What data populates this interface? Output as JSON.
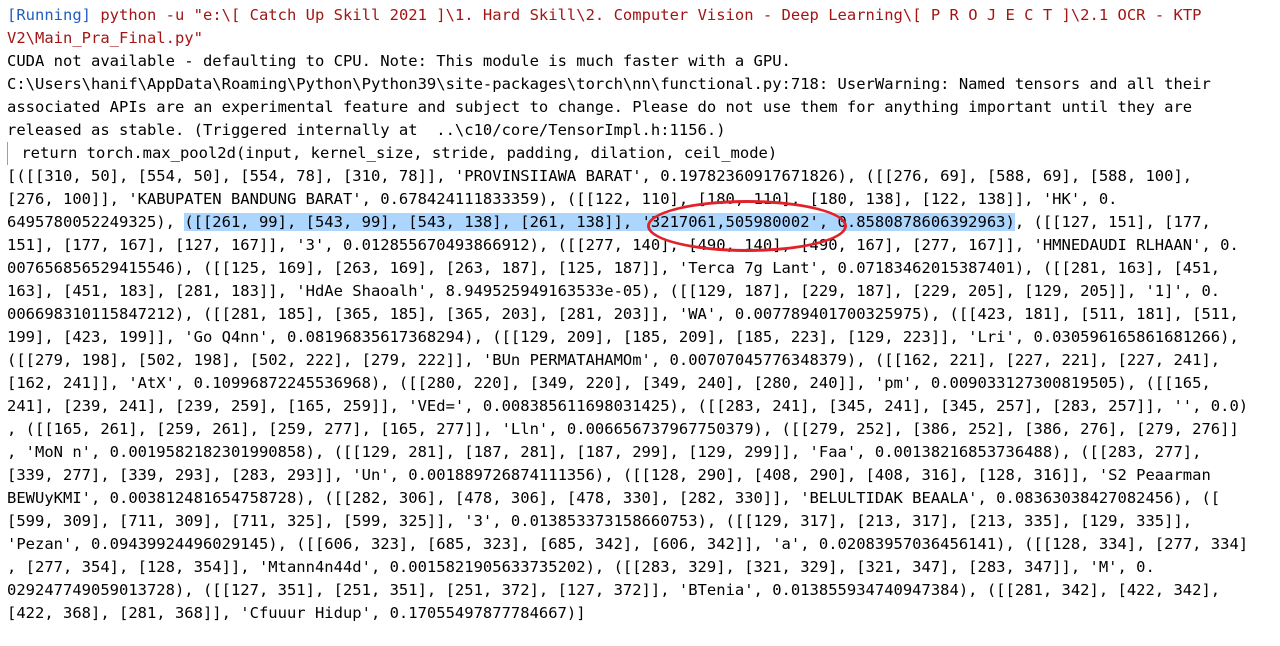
{
  "header": {
    "status": "[Running]",
    "command_line1": " python -u \"e:\\[ Catch Up Skill 2021 ]\\1. Hard Skill\\2. Computer Vision - Deep Learning\\[ P R O J E C T ]\\2.1 OCR - KTP",
    "command_line2": "V2\\Main_Pra_Final.py\""
  },
  "warnings": [
    "CUDA not available - defaulting to CPU. Note: This module is much faster with a GPU.",
    "C:\\Users\\hanif\\AppData\\Roaming\\Python\\Python39\\site-packages\\torch\\nn\\functional.py:718: UserWarning: Named tensors and all their",
    "associated APIs are an experimental feature and subject to change. Please do not use them for anything important until they are",
    "released as stable. (Triggered internally at  ..\\c10/core/TensorImpl.h:1156.)",
    " return torch.max_pool2d(input, kernel_size, stride, padding, dilation, ceil_mode)"
  ],
  "output": {
    "line1": "[([[310, 50], [554, 50], [554, 78], [310, 78]], 'PROVINSIIAWA BARAT', 0.19782360917671826), ([[276, 69], [588, 69], [588, 100],",
    "line2": "[276, 100]], 'KABUPATEN BANDUNG BARAT', 0.678424111833359), ([[122, 110], [180, 110], [180, 138], [122, 138]], 'HK', 0.",
    "line3_pre": "6495780052249325), ",
    "line3_sel": "([[261, 99], [543, 99], [543, 138], [261, 138]], '3217061,505980002', 0.8580878606392963)",
    "line3_post": ", ([[127, 151], [177,",
    "line4": "151], [177, 167], [127, 167]], '3', 0.012855670493866912), ([[277, 140], [490, 140], [490, 167], [277, 167]], 'HMNEDAUDI RLHAAN', 0.",
    "line5": "007656856529415546), ([[125, 169], [263, 169], [263, 187], [125, 187]], 'Terca 7g Lant', 0.07183462015387401), ([[281, 163], [451,",
    "line6": "163], [451, 183], [281, 183]], 'HdAe Shaoalh', 8.949525949163533e-05), ([[129, 187], [229, 187], [229, 205], [129, 205]], '1]', 0.",
    "line7": "006698310115847212), ([[281, 185], [365, 185], [365, 203], [281, 203]], 'WA', 0.007789401700325975), ([[423, 181], [511, 181], [511,",
    "line8": "199], [423, 199]], 'Go Q4nn', 0.08196835617368294), ([[129, 209], [185, 209], [185, 223], [129, 223]], 'Lri', 0.030596165861681266),",
    "line9": "([[279, 198], [502, 198], [502, 222], [279, 222]], 'BUn PERMATAHAMOm', 0.00707045776348379), ([[162, 221], [227, 221], [227, 241],",
    "line10": "[162, 241]], 'AtX', 0.10996872245536968), ([[280, 220], [349, 220], [349, 240], [280, 240]], 'pm', 0.009033127300819505), ([[165,",
    "line11": "241], [239, 241], [239, 259], [165, 259]], 'VEd=', 0.008385611698031425), ([[283, 241], [345, 241], [345, 257], [283, 257]], '', 0.0)",
    "line12": ", ([[165, 261], [259, 261], [259, 277], [165, 277]], 'Lln', 0.006656737967750379), ([[279, 252], [386, 252], [386, 276], [279, 276]]",
    "line13": ", 'MoN n', 0.0019582182301990858), ([[129, 281], [187, 281], [187, 299], [129, 299]], 'Faa', 0.00138216853736488), ([[283, 277],",
    "line14": "[339, 277], [339, 293], [283, 293]], 'Un', 0.001889726874111356), ([[128, 290], [408, 290], [408, 316], [128, 316]], 'S2 Peaarman",
    "line15": "BEWUyKMI', 0.003812481654758728), ([[282, 306], [478, 306], [478, 330], [282, 330]], 'BELULTIDAK BEAALA', 0.08363038427082456), ([",
    "line16": "[599, 309], [711, 309], [711, 325], [599, 325]], '3', 0.013853373158660753), ([[129, 317], [213, 317], [213, 335], [129, 335]],",
    "line17": "'Pezan', 0.09439924496029145), ([[606, 323], [685, 323], [685, 342], [606, 342]], 'a', 0.02083957036456141), ([[128, 334], [277, 334]",
    "line18": ", [277, 354], [128, 354]], 'Mtann4n44d', 0.0015821905633735202), ([[283, 329], [321, 329], [321, 347], [283, 347]], 'M', 0.",
    "line19": "029247749059013728), ([[127, 351], [251, 351], [251, 372], [127, 372]], 'BTenia', 0.013855934740947384), ([[281, 342], [422, 342],",
    "line20": "[422, 368], [281, 368]], 'Cfuuur Hidup', 0.17055497877784667)]"
  },
  "colors": {
    "running": "#1f5fc0",
    "command": "#a31515",
    "selection": "#add6ff",
    "annotation_circle": "#e0232b"
  }
}
